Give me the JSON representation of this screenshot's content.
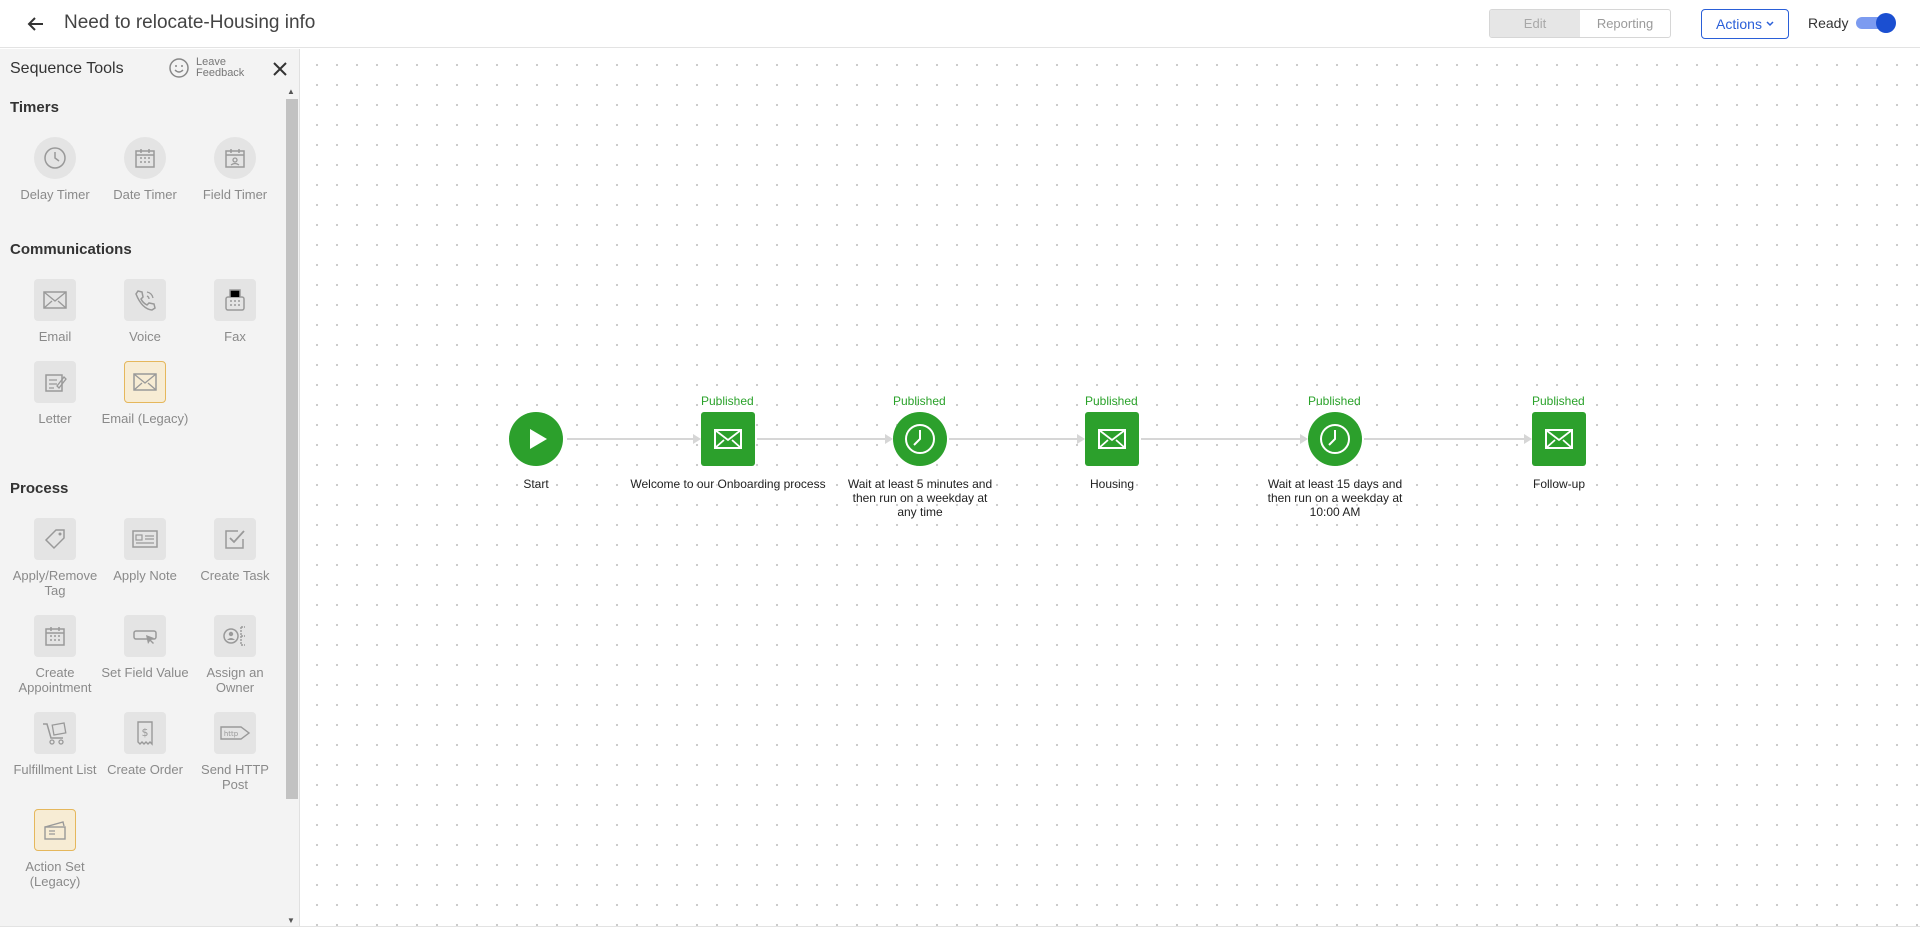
{
  "header": {
    "title": "Need to relocate-Housing info",
    "edit_label": "Edit",
    "reporting_label": "Reporting",
    "actions_label": "Actions",
    "ready_label": "Ready",
    "ready_on": true
  },
  "sidebar": {
    "title": "Sequence Tools",
    "feedback_label": "Leave Feedback",
    "sections": {
      "timers": {
        "title": "Timers",
        "items": [
          {
            "label": "Delay Timer",
            "icon": "clock-icon"
          },
          {
            "label": "Date Timer",
            "icon": "calendar-icon"
          },
          {
            "label": "Field Timer",
            "icon": "field-calendar-icon"
          }
        ]
      },
      "communications": {
        "title": "Communications",
        "items": [
          {
            "label": "Email",
            "icon": "envelope-icon"
          },
          {
            "label": "Voice",
            "icon": "phone-icon"
          },
          {
            "label": "Fax",
            "icon": "fax-icon"
          },
          {
            "label": "Letter",
            "icon": "letter-icon"
          },
          {
            "label": "Email (Legacy)",
            "icon": "envelope-icon"
          }
        ]
      },
      "process": {
        "title": "Process",
        "items": [
          {
            "label": "Apply/Remove Tag",
            "icon": "tag-icon"
          },
          {
            "label": "Apply Note",
            "icon": "note-icon"
          },
          {
            "label": "Create Task",
            "icon": "task-icon"
          },
          {
            "label": "Create Appointment",
            "icon": "calendar-icon"
          },
          {
            "label": "Set Field Value",
            "icon": "field-value-icon"
          },
          {
            "label": "Assign an Owner",
            "icon": "owner-icon"
          },
          {
            "label": "Fulfillment List",
            "icon": "fulfillment-icon"
          },
          {
            "label": "Create Order",
            "icon": "order-icon"
          },
          {
            "label": "Send HTTP Post",
            "icon": "http-icon"
          },
          {
            "label": "Action Set (Legacy)",
            "icon": "action-set-icon"
          }
        ]
      }
    }
  },
  "flow": {
    "colors": {
      "node": "#2ca02c",
      "status": "#2aa22a",
      "connector": "#d6d6d6"
    },
    "nodes": [
      {
        "type": "start",
        "status": "",
        "label": "Start"
      },
      {
        "type": "email",
        "status": "Published",
        "label": "Welcome to our Onboarding process"
      },
      {
        "type": "timer",
        "status": "Published",
        "label": "Wait at least 5 minutes and then run on a weekday at any time"
      },
      {
        "type": "email",
        "status": "Published",
        "label": "Housing"
      },
      {
        "type": "timer",
        "status": "Published",
        "label": "Wait at least 15 days and then run on a weekday at 10:00 AM"
      },
      {
        "type": "email",
        "status": "Published",
        "label": "Follow-up"
      }
    ]
  }
}
